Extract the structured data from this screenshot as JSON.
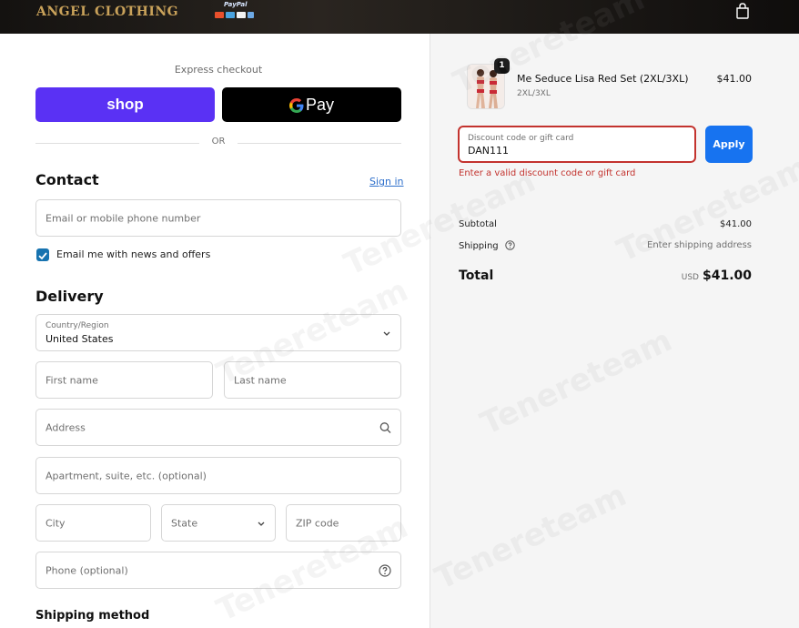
{
  "header": {
    "logo": "ANGEL CLOTHING",
    "paypal_label": "PayPal",
    "bag_icon": "bag-icon"
  },
  "express": {
    "label": "Express checkout",
    "shop_label": "shop",
    "gpay_label": "Pay",
    "or_label": "OR"
  },
  "contact": {
    "title": "Contact",
    "sign_in": "Sign in",
    "email_placeholder": "Email or mobile phone number",
    "newsletter_label": "Email me with news and offers",
    "newsletter_checked": true
  },
  "delivery": {
    "title": "Delivery",
    "country_label": "Country/Region",
    "country_value": "United States",
    "first_name": "First name",
    "last_name": "Last name",
    "address": "Address",
    "apartment": "Apartment, suite, etc. (optional)",
    "city": "City",
    "state": "State",
    "zip": "ZIP code",
    "phone": "Phone (optional)"
  },
  "shipping_method": {
    "title": "Shipping method"
  },
  "cart": {
    "quantity": "1",
    "product_name": "Me Seduce Lisa Red Set (2XL/3XL)",
    "variant": "2XL/3XL",
    "price": "$41.00"
  },
  "discount": {
    "label": "Discount code or gift card",
    "value": "DAN111",
    "apply": "Apply",
    "error": "Enter a valid discount code or gift card"
  },
  "summary": {
    "subtotal_label": "Subtotal",
    "subtotal_value": "$41.00",
    "shipping_label": "Shipping",
    "shipping_value": "Enter shipping address",
    "total_label": "Total",
    "currency": "USD",
    "total_value": "$41.00"
  },
  "colors": {
    "shop": "#5a31f4",
    "apply": "#1773f0",
    "error": "#c3332e",
    "link": "#2c6ecb"
  },
  "watermark": {
    "text": "Tenereteam"
  }
}
